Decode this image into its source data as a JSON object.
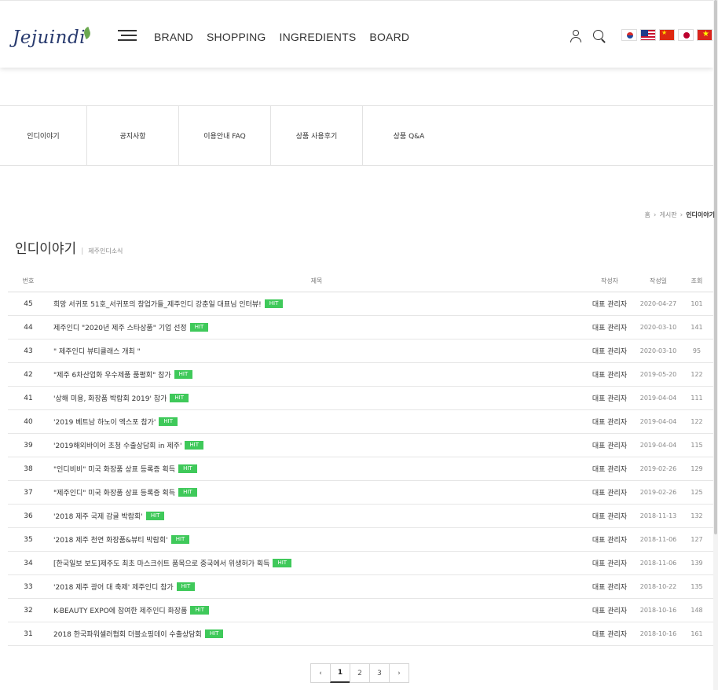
{
  "header": {
    "logo_text": "Jejuindi",
    "nav": [
      "BRAND",
      "SHOPPING",
      "INGREDIENTS",
      "BOARD"
    ],
    "flags": [
      "korean-flag",
      "us-flag",
      "china-flag",
      "japan-flag",
      "vietnam-flag"
    ]
  },
  "subtabs": [
    "인디이야기",
    "공지사항",
    "이용안내 FAQ",
    "상품 사용후기",
    "상품 Q&A"
  ],
  "breadcrumb": {
    "home": "홈",
    "board": "게시판",
    "current": "인디이야기"
  },
  "board": {
    "title": "인디이야기",
    "subtitle": "제주인디소식"
  },
  "table": {
    "headers": {
      "no": "번호",
      "subject": "제목",
      "writer": "작성자",
      "date": "작성일",
      "hits": "조회"
    },
    "hit_label": "HIT",
    "rows": [
      {
        "no": "45",
        "subject": "희망 서귀포 51호_서귀포의 창업가들_제주인디 강춘일 대표님 인터뷰!",
        "hit": true,
        "writer": "대표 관리자",
        "date": "2020-04-27",
        "hits": "101"
      },
      {
        "no": "44",
        "subject": "제주인디 \"2020년 제주 스타상품\" 기업 선정",
        "hit": true,
        "writer": "대표 관리자",
        "date": "2020-03-10",
        "hits": "141"
      },
      {
        "no": "43",
        "subject": "\" 제주인디 뷰티클래스 개최 \"",
        "hit": false,
        "writer": "대표 관리자",
        "date": "2020-03-10",
        "hits": "95"
      },
      {
        "no": "42",
        "subject": "\"제주 6차산업화 우수제품 품평회\" 참가",
        "hit": true,
        "writer": "대표 관리자",
        "date": "2019-05-20",
        "hits": "122"
      },
      {
        "no": "41",
        "subject": "'상해 미용, 화장품 박람회 2019' 참가",
        "hit": true,
        "writer": "대표 관리자",
        "date": "2019-04-04",
        "hits": "111"
      },
      {
        "no": "40",
        "subject": "'2019 베트남 하노이 엑스포 참가'",
        "hit": true,
        "writer": "대표 관리자",
        "date": "2019-04-04",
        "hits": "122"
      },
      {
        "no": "39",
        "subject": "'2019해외바이어 초청 수출상담회 in 제주'",
        "hit": true,
        "writer": "대표 관리자",
        "date": "2019-04-04",
        "hits": "115"
      },
      {
        "no": "38",
        "subject": "\"인디비비\" 미국 화장품 상표 등록증 획득",
        "hit": true,
        "writer": "대표 관리자",
        "date": "2019-02-26",
        "hits": "129"
      },
      {
        "no": "37",
        "subject": "\"제주인디\" 미국 화장품 상표 등록증 획득",
        "hit": true,
        "writer": "대표 관리자",
        "date": "2019-02-26",
        "hits": "125"
      },
      {
        "no": "36",
        "subject": "'2018 제주 국제 감귤 박람회'",
        "hit": true,
        "writer": "대표 관리자",
        "date": "2018-11-13",
        "hits": "132"
      },
      {
        "no": "35",
        "subject": "'2018 제주 천연 화장품&뷰티 박람회'",
        "hit": true,
        "writer": "대표 관리자",
        "date": "2018-11-06",
        "hits": "127"
      },
      {
        "no": "34",
        "subject": "[한국일보 보도]제주도 최초 마스크쉬트 품목으로 중국에서 위생허가 획득",
        "hit": true,
        "writer": "대표 관리자",
        "date": "2018-11-06",
        "hits": "139"
      },
      {
        "no": "33",
        "subject": "'2018 제주 광어 대 축제' 제주인디 참가",
        "hit": true,
        "writer": "대표 관리자",
        "date": "2018-10-22",
        "hits": "135"
      },
      {
        "no": "32",
        "subject": "K-BEAUTY EXPO에 참여한 제주인디 화장품",
        "hit": true,
        "writer": "대표 관리자",
        "date": "2018-10-16",
        "hits": "148"
      },
      {
        "no": "31",
        "subject": "2018 한국파워셀러협회 더블쇼핑데이 수출상담회",
        "hit": true,
        "writer": "대표 관리자",
        "date": "2018-10-16",
        "hits": "161"
      }
    ]
  },
  "pagination": {
    "prev": "‹",
    "pages": [
      "1",
      "2",
      "3"
    ],
    "current": "1",
    "next": "›"
  }
}
